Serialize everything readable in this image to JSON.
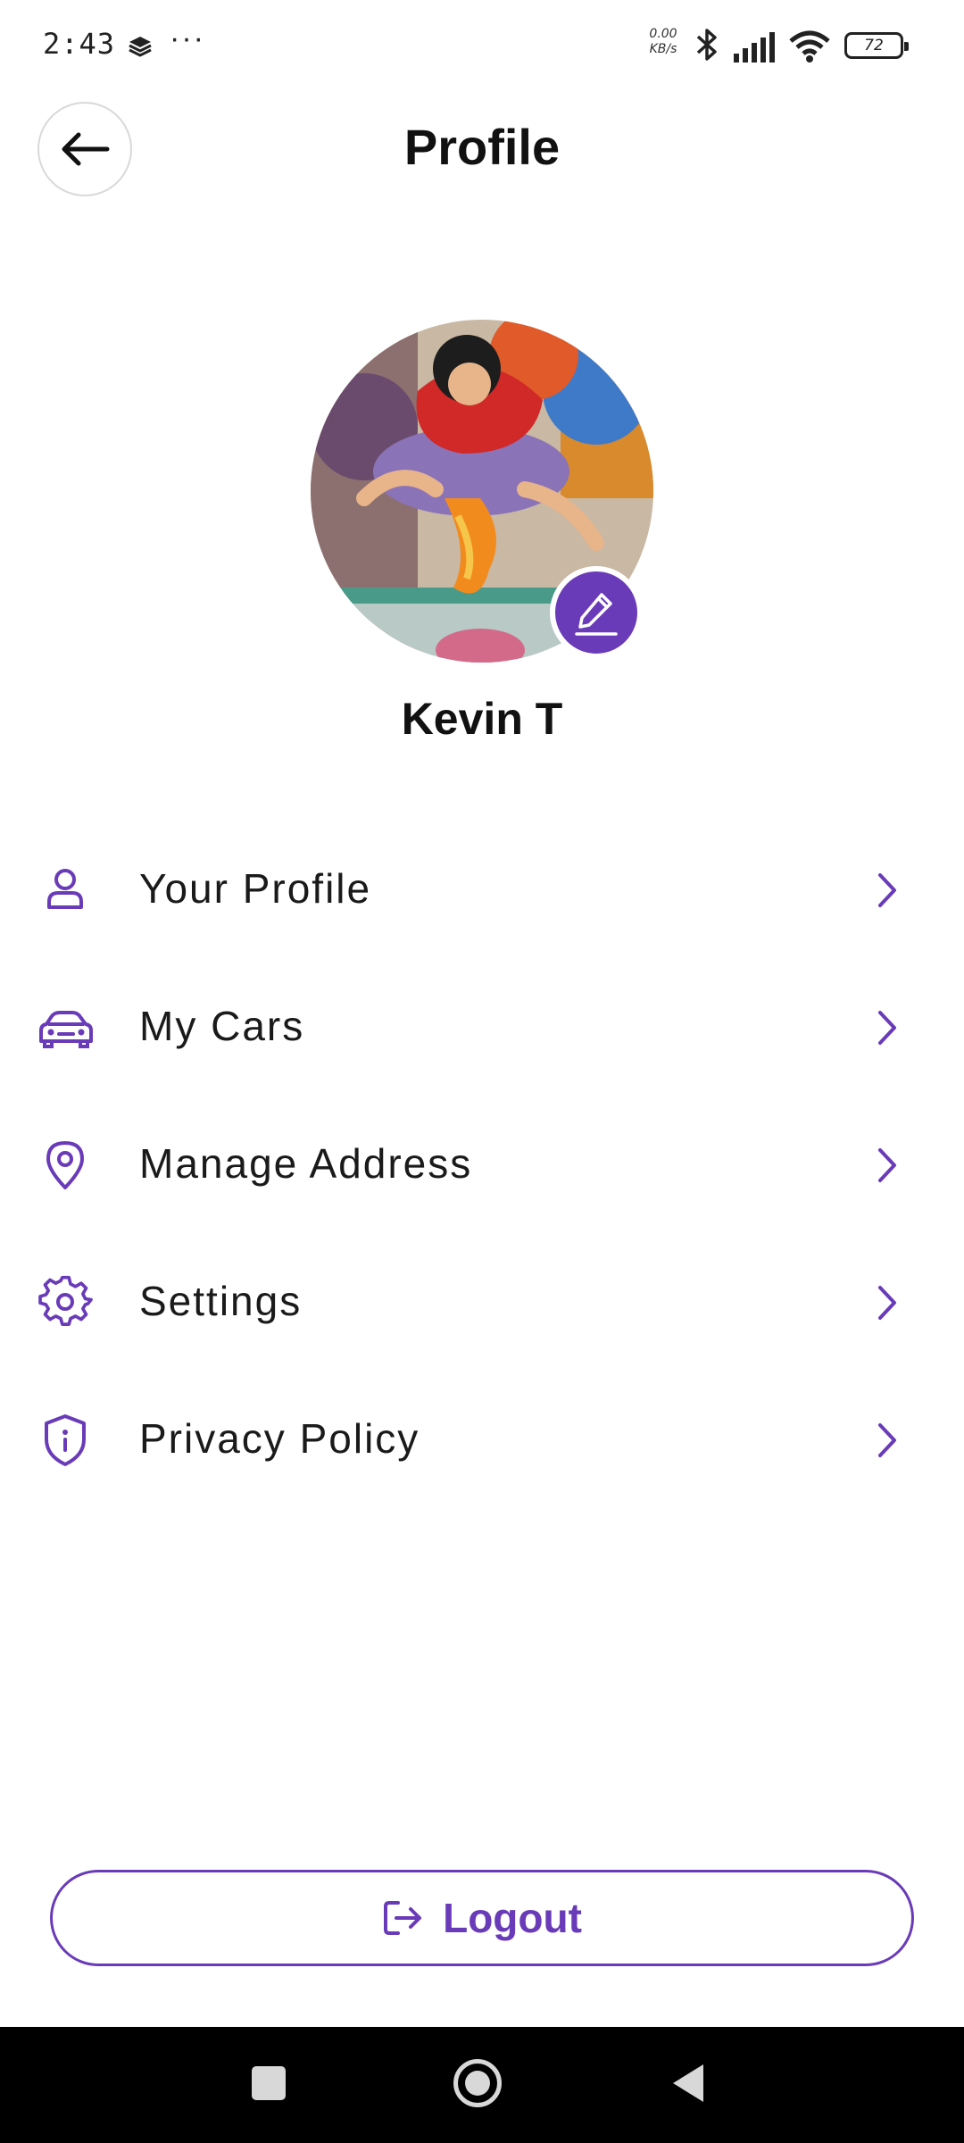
{
  "status_bar": {
    "time": "2:43",
    "more": "···",
    "net_speed_value": "0.00",
    "net_speed_unit": "KB/s",
    "battery": "72",
    "icons": [
      "layers-icon",
      "bluetooth-icon",
      "signal-icon",
      "wifi-icon",
      "battery-icon"
    ]
  },
  "header": {
    "title": "Profile",
    "back_icon": "arrow-left-icon"
  },
  "profile": {
    "name": "Kevin T",
    "edit_icon": "pencil-icon"
  },
  "menu": {
    "items": [
      {
        "label": "Your Profile",
        "icon": "user-icon"
      },
      {
        "label": "My Cars",
        "icon": "car-icon"
      },
      {
        "label": "Manage Address",
        "icon": "location-pin-icon"
      },
      {
        "label": "Settings",
        "icon": "gear-icon"
      },
      {
        "label": "Privacy Policy",
        "icon": "shield-info-icon"
      }
    ]
  },
  "logout": {
    "label": "Logout",
    "icon": "logout-icon"
  },
  "colors": {
    "accent": "#6a3bb8",
    "text": "#111111",
    "background": "#ffffff",
    "nav_bar": "#000000"
  }
}
